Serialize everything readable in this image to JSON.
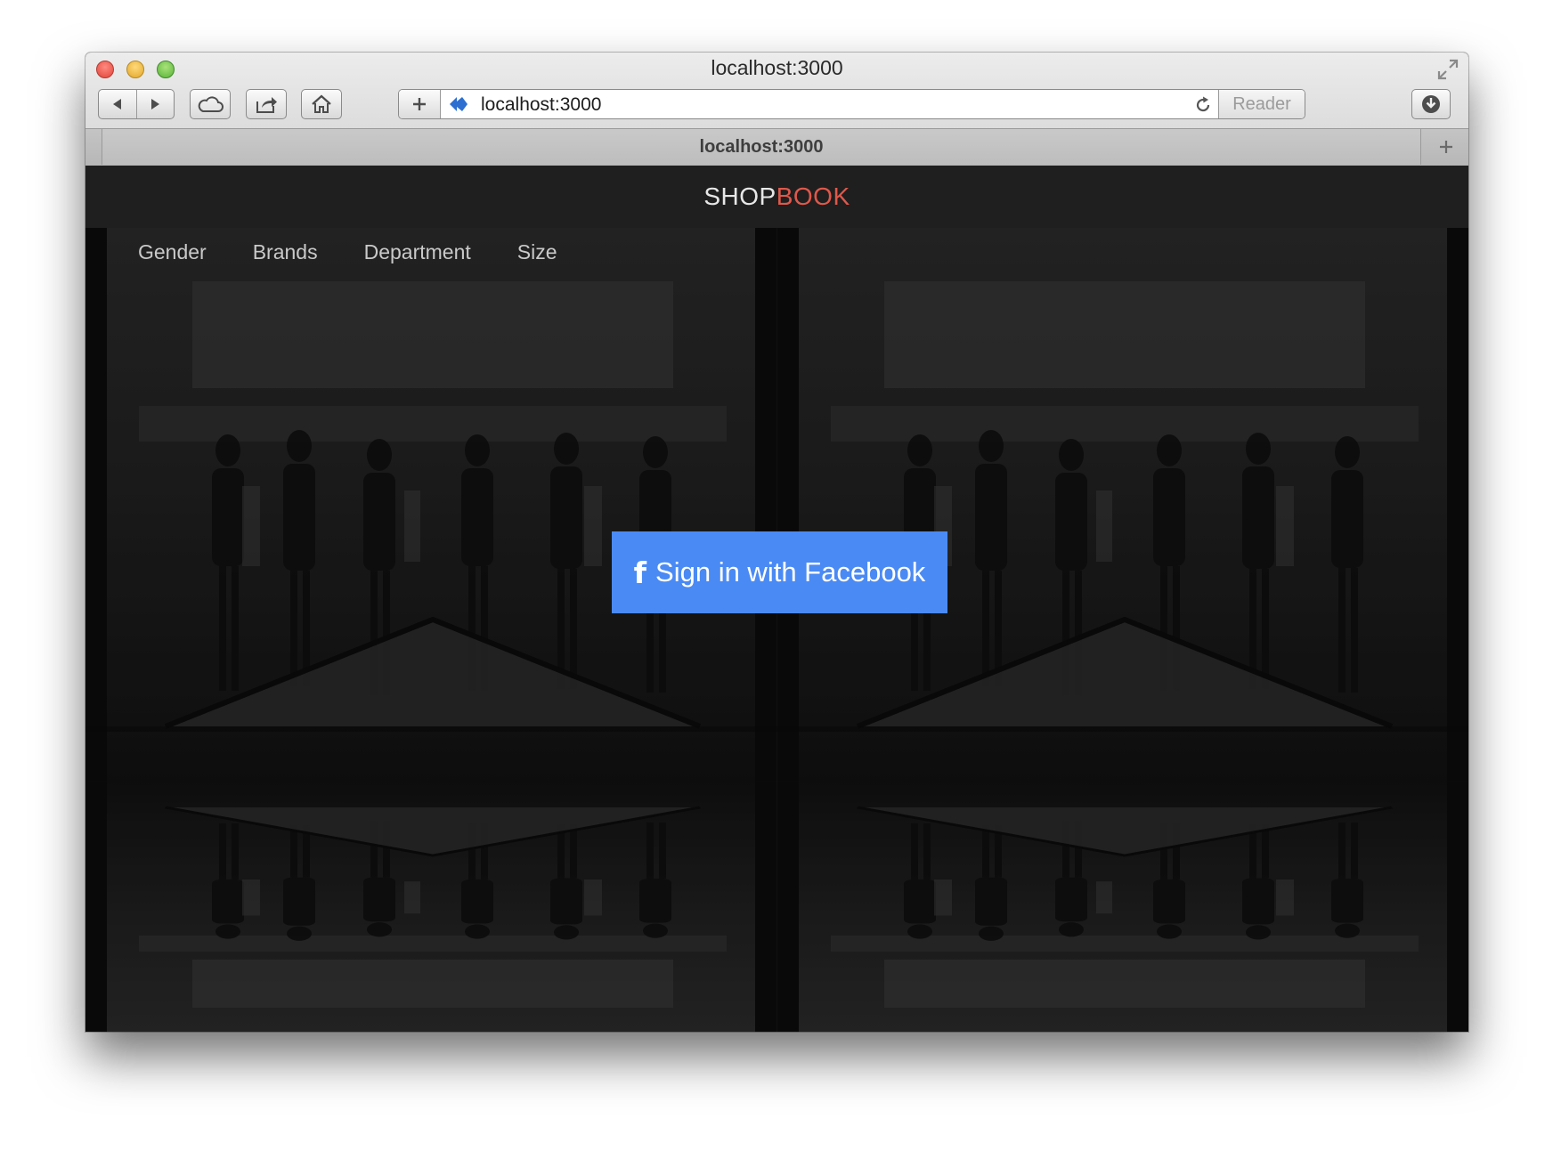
{
  "window": {
    "title": "localhost:3000"
  },
  "toolbar": {
    "url": "localhost:3000",
    "reader_label": "Reader"
  },
  "tab": {
    "title": "localhost:3000"
  },
  "site": {
    "brand_part1": "SHOP",
    "brand_part2": "BOOK",
    "brand_colors": {
      "primary": "#e7e7e7",
      "accent": "#e0584b"
    },
    "nav": [
      "Gender",
      "Brands",
      "Department",
      "Size"
    ],
    "cta": {
      "icon": "f",
      "label": "Sign in with Facebook",
      "color": "#4a8af4"
    }
  },
  "icons": {
    "close": "close-button-icon",
    "minimize": "minimize-button-icon",
    "maximize": "zoom-button-icon",
    "fullscreen": "fullscreen-arrows-icon",
    "back": "back-arrow-icon",
    "forward": "forward-arrow-icon",
    "cloud": "icloud-tabs-icon",
    "share": "share-icon",
    "home": "home-icon",
    "add": "plus-icon",
    "favicon": "site-favicon-icon",
    "reload": "reload-icon",
    "downloads": "downloads-icon",
    "new_tab": "new-tab-plus-icon",
    "facebook": "facebook-f-icon"
  }
}
